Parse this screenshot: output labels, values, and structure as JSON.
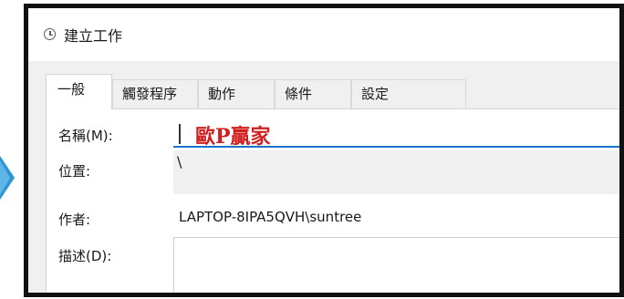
{
  "window": {
    "title": "建立工作",
    "icon": "clock-icon"
  },
  "tabs": [
    {
      "label": "一般",
      "active": true
    },
    {
      "label": "觸發程序",
      "active": false
    },
    {
      "label": "動作",
      "active": false
    },
    {
      "label": "條件",
      "active": false
    },
    {
      "label": "設定",
      "active": false
    }
  ],
  "general": {
    "name_label": "名稱(M):",
    "name_value": "歐P贏家",
    "location_label": "位置:",
    "location_value": "\\",
    "author_label": "作者:",
    "author_value": "LAPTOP-8IPA5QVH\\suntree",
    "description_label": "描述(D):",
    "description_value": ""
  },
  "colors": {
    "accent": "#1a73c9",
    "name_text": "#d0201f",
    "arrow": "#2f95d1",
    "frame": "#111111"
  }
}
